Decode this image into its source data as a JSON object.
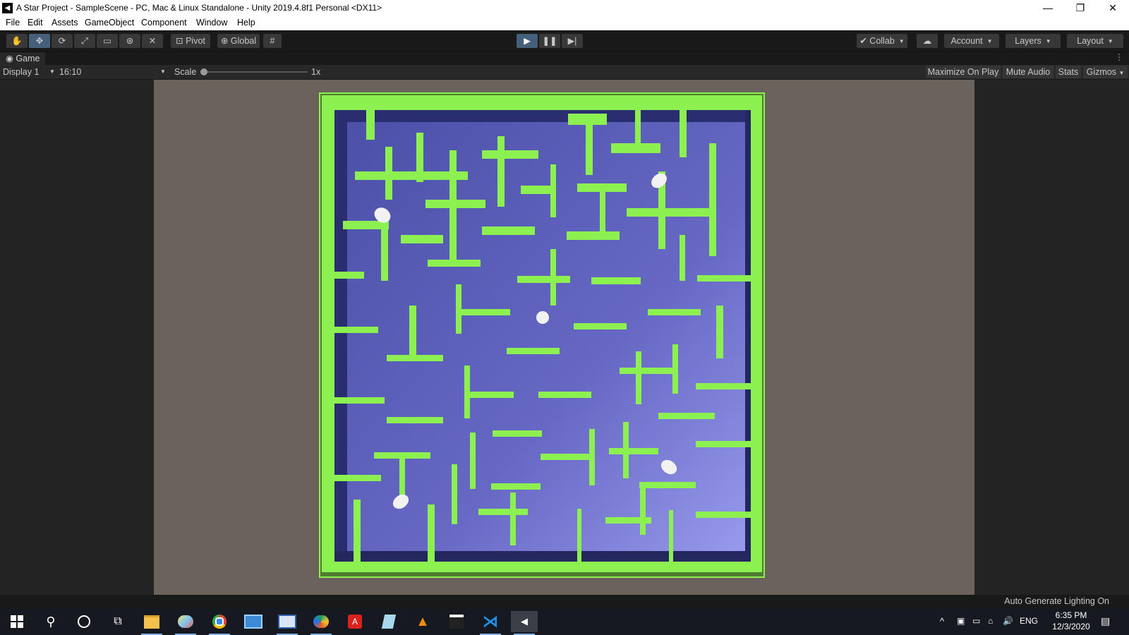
{
  "window": {
    "title": "A Star Project - SampleScene - PC, Mac & Linux Standalone - Unity 2019.4.8f1 Personal <DX11>",
    "minimize": "—",
    "restore": "❐",
    "close": "✕"
  },
  "menu": [
    "File",
    "Edit",
    "Assets",
    "GameObject",
    "Component",
    "Window",
    "Help"
  ],
  "toolbar": {
    "pivot_label": "Pivot",
    "global_label": "Global",
    "collab_label": "Collab",
    "account_label": "Account",
    "layers_label": "Layers",
    "layout_label": "Layout"
  },
  "game_tab": {
    "label": "Game",
    "display": "Display 1",
    "aspect": "16:10",
    "scale_label": "Scale",
    "scale_value": "1x",
    "scale_level": 0,
    "maximize_on_play": "Maximize On Play",
    "mute_audio": "Mute Audio",
    "stats": "Stats",
    "gizmos": "Gizmos"
  },
  "maze": {
    "floor_color": "#5558b0",
    "wall_color": "#8cf050",
    "orb_count": 5
  },
  "status": {
    "lighting": "Auto Generate Lighting On"
  },
  "taskbar": {
    "apps": [
      "windows-start-icon",
      "search-icon",
      "cortana-icon",
      "task-view-icon",
      "file-explorer-icon",
      "paint-icon",
      "chrome-icon",
      "control-panel-icon",
      "display-icon",
      "color-app-icon",
      "acrobat-icon",
      "notepad-icon",
      "vlc-icon",
      "video-editor-icon",
      "vscode-icon",
      "unity-icon"
    ],
    "language": "ENG",
    "time": "6:35 PM",
    "date": "12/3/2020"
  }
}
